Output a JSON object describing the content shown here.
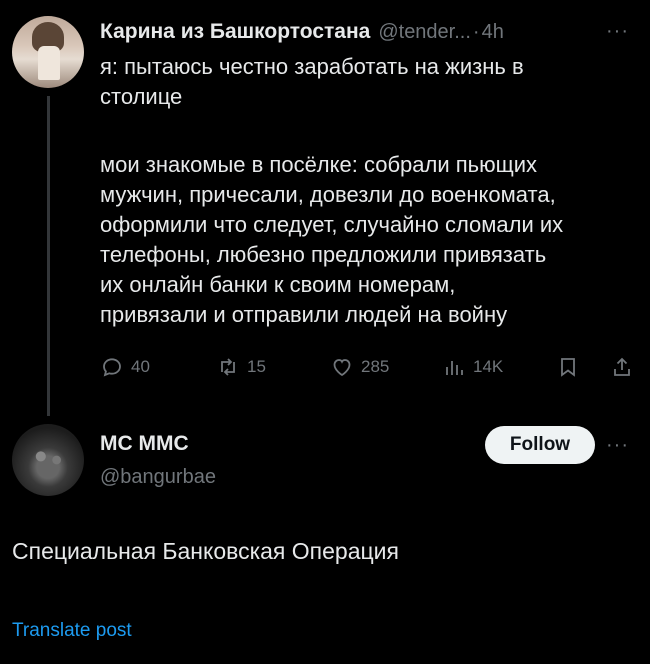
{
  "tweet": {
    "author_name": "Карина из Башкортостана",
    "author_handle": "@tender...",
    "separator": "·",
    "time": "4h",
    "more": "···",
    "text_line1": "я: пытаюсь честно заработать на жизнь в",
    "text_line2": "столице",
    "text_line3": "мои знакомые в посёлке: собрали пьющих",
    "text_line4": "мужчин, причесали, довезли до военкомата,",
    "text_line5": "оформили что следует, случайно сломали их",
    "text_line6": "телефоны, любезно предложили привязать",
    "text_line7": "их онлайн банки к своим номерам,",
    "text_line8": "привязали и отправили людей на войну",
    "actions": {
      "replies": "40",
      "reposts": "15",
      "likes": "285",
      "views": "14K"
    }
  },
  "reply": {
    "author_name": "MC MMC",
    "author_handle": "@bangurbae",
    "follow_label": "Follow",
    "more": "···",
    "text": "Специальная Банковская Операция",
    "translate_label": "Translate post"
  },
  "icons": {
    "reply": "reply-icon",
    "repost": "repost-icon",
    "like": "heart-icon",
    "views": "views-icon",
    "bookmark": "bookmark-icon",
    "share": "share-icon"
  },
  "colors": {
    "background": "#000000",
    "text": "#e7e9ea",
    "secondary": "#71767b",
    "link": "#1d9bf0",
    "follow_bg": "#eff3f4"
  }
}
